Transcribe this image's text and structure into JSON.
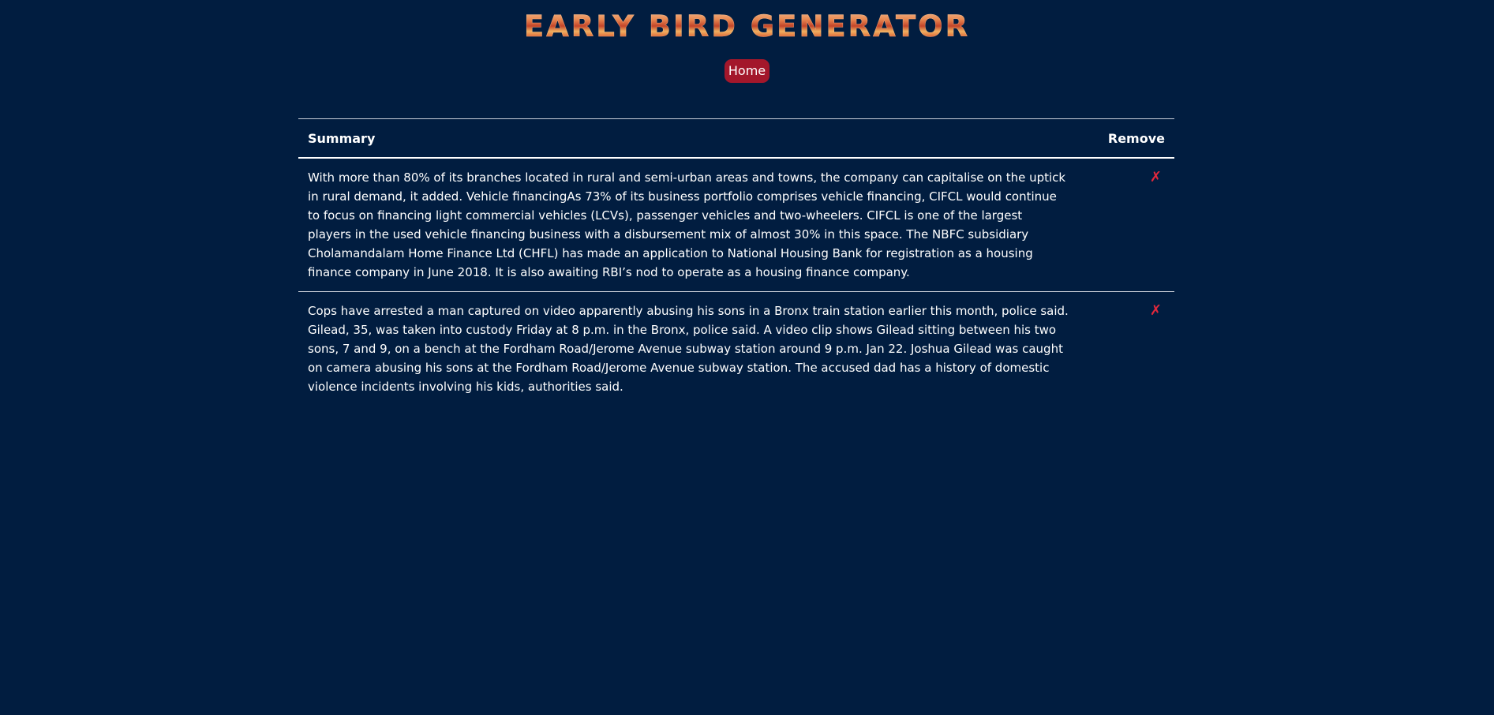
{
  "header": {
    "logo_text": "EARLY BIRD GENERATOR"
  },
  "nav": {
    "home_label": "Home"
  },
  "table": {
    "columns": {
      "summary": "Summary",
      "remove": "Remove"
    },
    "rows": [
      {
        "summary": "With more than 80% of its branches located in rural and semi-urban areas and towns, the company can capitalise on the uptick in rural demand, it added. Vehicle financingAs 73% of its business portfolio comprises vehicle financing, CIFCL would continue to focus on financing light commercial vehicles (LCVs), passenger vehicles and two-wheelers. CIFCL is one of the largest players in the used vehicle financing business with a disbursement mix of almost 30% in this space. The NBFC subsidiary Cholamandalam Home Finance Ltd (CHFL) has made an application to National Housing Bank for registration as a housing finance company in June 2018. It is also awaiting RBI’s nod to operate as a housing finance company.",
        "remove": "✗"
      },
      {
        "summary": "Cops have arrested a man captured on video apparently abusing his sons in a Bronx train station earlier this month, police said. Gilead, 35, was taken into custody Friday at 8 p.m. in the Bronx, police said. A video clip shows Gilead sitting between his two sons, 7 and 9, on a bench at the Fordham Road/Jerome Avenue subway station around 9 p.m. Jan 22. Joshua Gilead was caught on camera abusing his sons at the Fordham Road/Jerome Avenue subway station. The accused dad has a history of domestic violence incidents involving his kids, authorities said.",
        "remove": "✗"
      }
    ]
  },
  "colors": {
    "background": "#011d40",
    "home_button": "#a3172b",
    "remove_icon": "#e2283c"
  }
}
